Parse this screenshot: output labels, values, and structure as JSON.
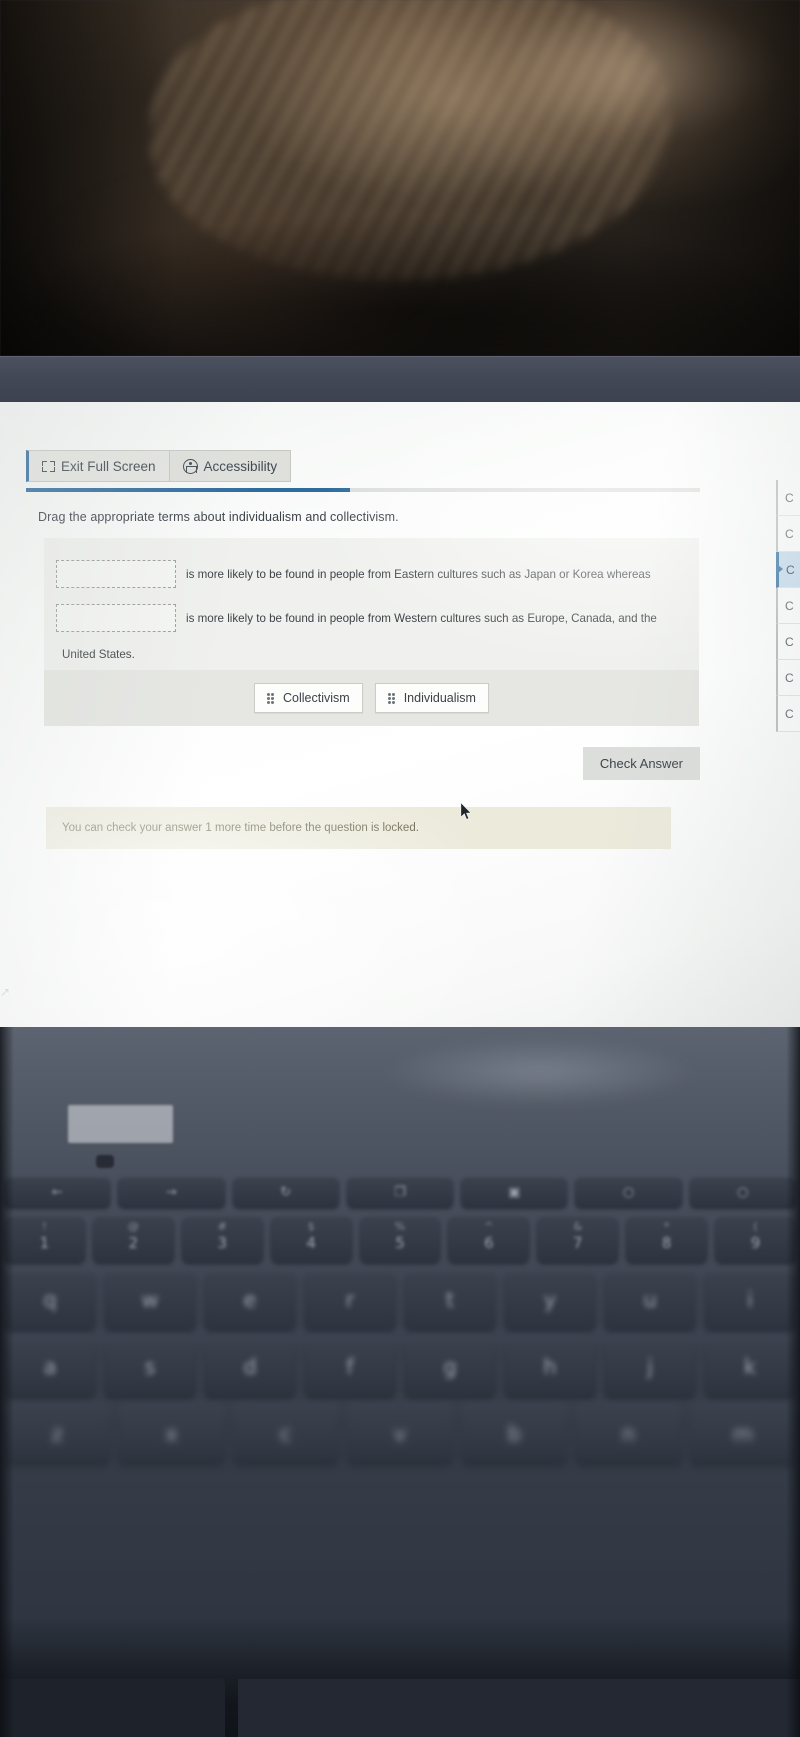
{
  "scene": {
    "description": "photo-of-laptop-screen"
  },
  "toolbar": {
    "exit_full_screen_label": "Exit Full Screen",
    "accessibility_label": "Accessibility",
    "exit_full_screen_icon": "fullscreen-exit-icon",
    "accessibility_icon": "accessibility-person-icon"
  },
  "progress": {
    "percent": 48
  },
  "question": {
    "prompt": "Drag the appropriate terms about individualism and collectivism.",
    "blanks": [
      {
        "placeholder": "",
        "fragment": "is more likely to be found in people from Eastern cultures such as Japan or Korea whereas"
      },
      {
        "placeholder": "",
        "fragment": "is more likely to be found in people from Western cultures such as Europe, Canada, and the"
      }
    ],
    "tail_text": "United States."
  },
  "word_bank": {
    "terms": [
      {
        "label": "Collectivism",
        "handle_icon": "drag-handle-icon"
      },
      {
        "label": "Individualism",
        "handle_icon": "drag-handle-icon"
      }
    ]
  },
  "actions": {
    "check_answer_label": "Check Answer"
  },
  "warning": {
    "text": "You can check your answer 1 more time before the question is locked."
  },
  "sidebar": {
    "items": [
      {
        "label": "C",
        "active": false
      },
      {
        "label": "C",
        "active": false
      },
      {
        "label": "C",
        "active": true
      },
      {
        "label": "C",
        "active": false
      },
      {
        "label": "C",
        "active": false
      },
      {
        "label": "C",
        "active": false
      },
      {
        "label": "C",
        "active": false
      }
    ]
  },
  "colors": {
    "accent_blue": "#2f6c9e",
    "panel_gray": "#f0f1ee",
    "bank_gray": "#e6e7e3",
    "warning_bg": "#eceadb",
    "warning_text": "#6d6a52"
  },
  "keyboard": {
    "function_row": [
      "←",
      "→",
      "↻",
      "❐",
      "▣",
      "○",
      "○"
    ],
    "number_row": [
      {
        "sup": "!",
        "main": "1"
      },
      {
        "sup": "@",
        "main": "2"
      },
      {
        "sup": "#",
        "main": "3"
      },
      {
        "sup": "$",
        "main": "4"
      },
      {
        "sup": "%",
        "main": "5"
      },
      {
        "sup": "^",
        "main": "6"
      },
      {
        "sup": "&",
        "main": "7"
      },
      {
        "sup": "*",
        "main": "8"
      },
      {
        "sup": "(",
        "main": "9"
      }
    ],
    "row_q": [
      "q",
      "w",
      "e",
      "r",
      "t",
      "y",
      "u",
      "i"
    ],
    "row_a": [
      "a",
      "s",
      "d",
      "f",
      "g",
      "h",
      "j",
      "k"
    ],
    "row_z": [
      "z",
      "x",
      "c",
      "v",
      "b",
      "n",
      "m"
    ]
  }
}
